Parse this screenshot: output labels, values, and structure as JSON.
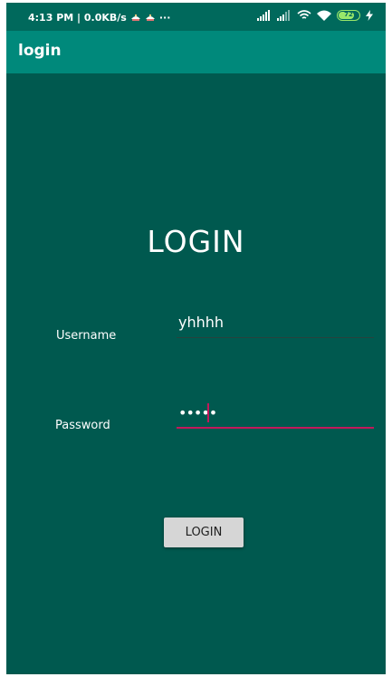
{
  "status_bar": {
    "time_speed": "4:13 PM | 0.0KB/s",
    "more_indicator": "···",
    "battery_level": "72",
    "icons_left": [
      "notification-icon",
      "notification-icon"
    ],
    "icons_right": [
      "cellular-signal-icon",
      "cellular-signal-icon",
      "wifi-icon",
      "wifi-icon",
      "battery-icon",
      "charging-bolt-icon"
    ]
  },
  "app_bar": {
    "title": "login"
  },
  "form": {
    "heading": "LOGIN",
    "username": {
      "label": "Username",
      "value": "yhhhh"
    },
    "password": {
      "label": "Password",
      "value": "•••••"
    },
    "submit_label": "LOGIN"
  },
  "colors": {
    "status_bar": "#00695c",
    "app_bar": "#00897b",
    "background": "#00594f",
    "accent": "#c2185b",
    "button": "#d6d6d6"
  }
}
